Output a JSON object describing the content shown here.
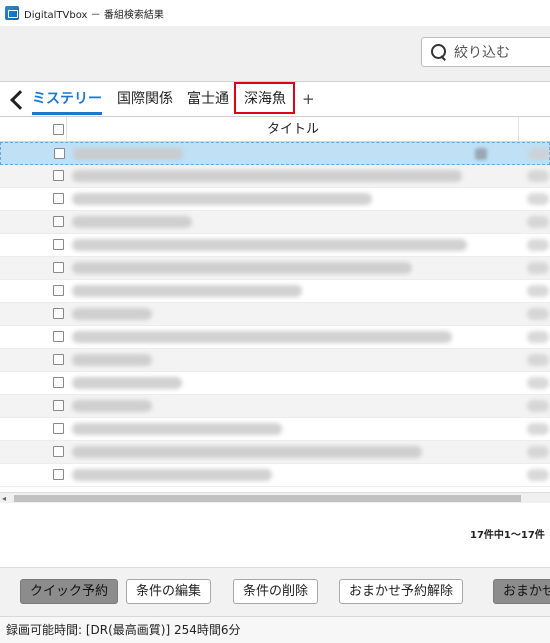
{
  "window": {
    "title": "DigitalTVbox － 番組検索結果",
    "icon": "tv-app-icon"
  },
  "search": {
    "placeholder": "絞り込む",
    "icon": "search-icon"
  },
  "tabs": {
    "back_icon": "chevron-left-icon",
    "items": [
      {
        "label": "ミステリー",
        "active": true
      },
      {
        "label": "国際関係",
        "active": false
      },
      {
        "label": "富士通",
        "active": false
      },
      {
        "label": "深海魚",
        "active": false,
        "highlighted": true
      }
    ],
    "add_label": "+",
    "accent_color": "#1b78d0",
    "highlight_color": "#e0001b"
  },
  "table": {
    "columns": {
      "title": "タイトル"
    },
    "row_count": 15,
    "selected_row": 1
  },
  "pager": {
    "text": "17件中1～17件"
  },
  "actions": {
    "quick_reserve": "クイック予約",
    "edit_condition": "条件の編集",
    "delete_condition": "条件の削除",
    "cancel_auto_reserve": "おまかせ予約解除",
    "auto": "おまかせ"
  },
  "status": {
    "text": "録画可能時間: [DR(最高画質)] 254時間6分"
  }
}
